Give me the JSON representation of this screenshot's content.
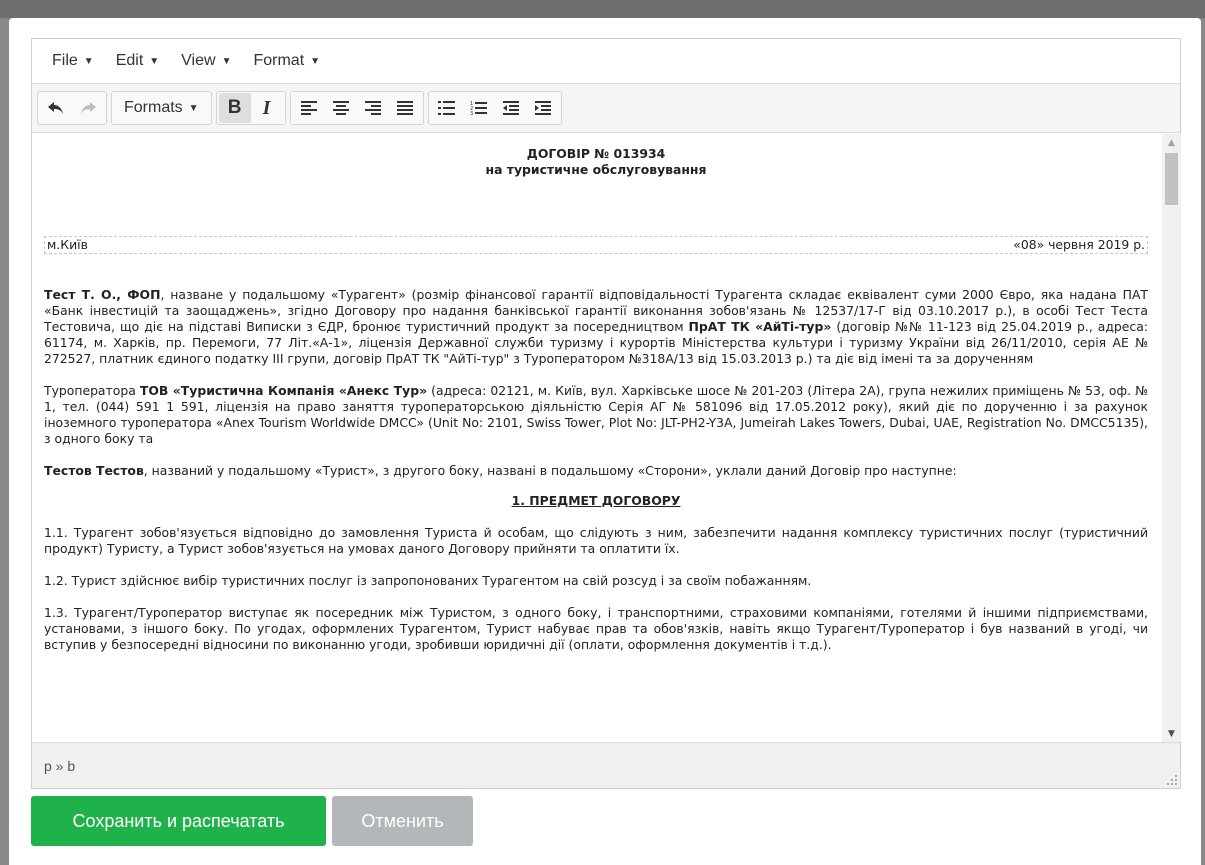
{
  "menubar": {
    "file": "File",
    "edit": "Edit",
    "view": "View",
    "format": "Format"
  },
  "toolbar": {
    "formats_label": "Formats",
    "bold_label": "B",
    "italic_label": "I"
  },
  "document": {
    "title_line1": "ДОГОВІР № 013934",
    "title_line2": "на туристичне обслуговування",
    "city": "м.Київ",
    "date": "«08» червня 2019 р.",
    "p1_b1": "Тест Т. О., ФОП",
    "p1_t1": ", назване у подальшому «Турагент» (розмір фінансової гарантії відповідальності Турагента складає еквівалент суми 2000 Євро, яка надана ПАТ «Банк інвестицій та заощаджень», згідно Договору про надання банківської гарантії виконання зобов'язань № 12537/17-Г від 03.10.2017 р.), в особі Тест Теста Тестовича, що діє на підставі Виписки з ЄДР, бронює туристичний продукт за посередництвом ",
    "p1_b2": "ПрАТ ТК «АйТі-тур»",
    "p1_t2": " (договір №№ 11-123 від 25.04.2019 р., адреса: 61174, м. Харків, пр. Перемоги, 77 Літ.«А-1», ліцензія Державної служби туризму і курортів Міністерства культури і туризму України від 26/11/2010, серія АЕ № 272527, платник єдиного податку III групи, договір ПрАТ ТК \"АйТі-тур\" з Туроператором №318А/13 від 15.03.2013 р.) та діє від імені та за дорученням",
    "p2_t1": "Туроператора ",
    "p2_b1": "ТОВ «Туристична Компанія «Анекс Тур»",
    "p2_t2": " (адреса: 02121, м. Київ, вул. Харківське шосе № 201-203 (Літера 2А), група нежилих приміщень № 53, оф. № 1, тел. (044) 591 1 591, ліцензія на право заняття туроператорською діяльністю Серія АГ № 581096 від 17.05.2012 року), який діє по дорученню і за рахунок іноземного туроператора «Anex Tourism Worldwide DMCC» (Unit No: 2101, Swiss Tower, Plot No: JLT-PH2-Y3A, Jumeirah Lakes Towers, Dubai, UAE, Registration No. DMCC5135), з одного боку та",
    "p3_b1": "Тестов Тестов",
    "p3_t1": ", названий у подальшому «Турист», з другого боку, названі в подальшому «Сторони», уклали даний Договір про наступне:",
    "section1_title": "1. ПРЕДМЕТ ДОГОВОРУ",
    "p_1_1": "1.1. Турагент зобов'язується відповідно до замовлення Туриста й особам, що слідують з ним, забезпечити надання комплексу туристичних послуг (туристичний продукт) Туристу, а Турист зобов'язується на умовах даного Договору прийняти та оплатити їх.",
    "p_1_2": "1.2. Турист здійснює вибір туристичних послуг із запропонованих Турагентом на свій розсуд і за своїм побажанням.",
    "p_1_3": "1.3. Турагент/Туроператор виступає як посередник між Туристом, з одного боку, і транспортними, страховими компаніями, готелями й іншими підприємствами, установами, з іншого боку. По угодах, оформлених Турагентом, Турист набуває прав та обов'язків, навіть якщо Турагент/Туроператор і був названий в угоді, чи вступив у безпосередні відносини по виконанню угоди, зробивши юридичні дії (оплати, оформлення документів і т.д.)."
  },
  "statusbar": {
    "path": "p » b"
  },
  "buttons": {
    "save": "Сохранить и распечатать",
    "cancel": "Отменить"
  },
  "colors": {
    "save_button": "#1fb24a",
    "cancel_button": "#b3b7ba"
  }
}
